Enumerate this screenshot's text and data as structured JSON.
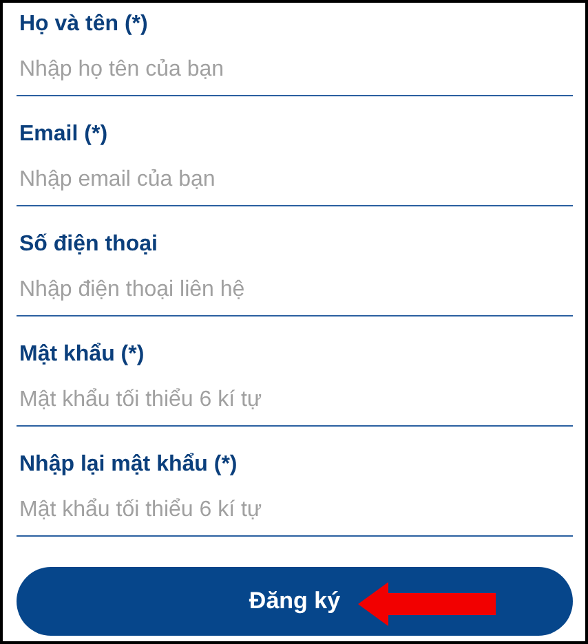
{
  "fields": [
    {
      "label": "Họ và tên (*)",
      "placeholder": "Nhập họ tên của bạn"
    },
    {
      "label": "Email (*)",
      "placeholder": "Nhập email của bạn"
    },
    {
      "label": "Số điện thoại",
      "placeholder": "Nhập điện thoại liên hệ"
    },
    {
      "label": "Mật khẩu (*)",
      "placeholder": "Mật khẩu tối thiểu 6 kí tự"
    },
    {
      "label": "Nhập lại mật khẩu (*)",
      "placeholder": "Mật khẩu tối thiểu 6 kí tự"
    }
  ],
  "submit_button": "Đăng ký"
}
